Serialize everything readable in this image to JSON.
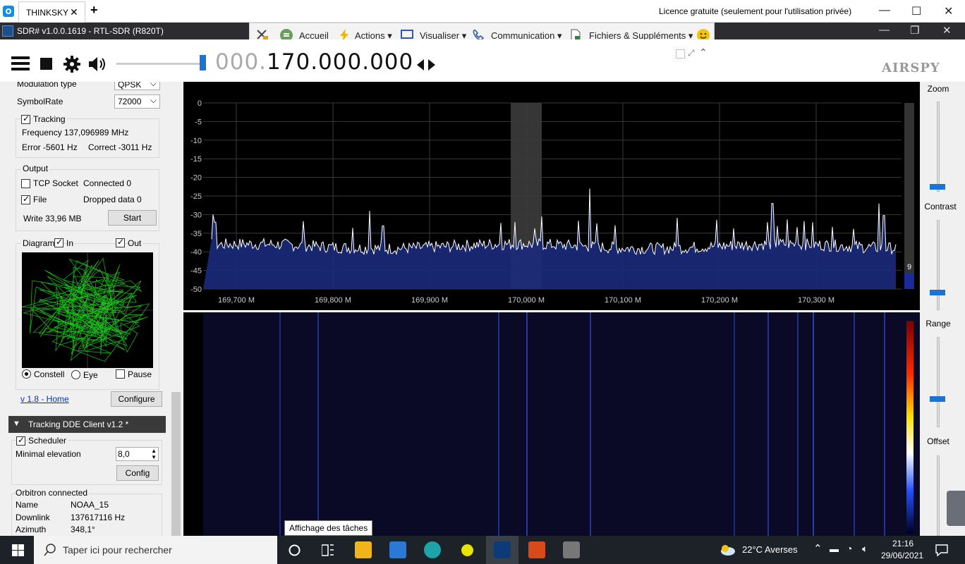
{
  "tv": {
    "tab_label": "THINKSKY",
    "tab_close": "✕",
    "new_tab": "+",
    "licence": "Licence gratuite (seulement pour l'utilisation privée)",
    "toolbar": {
      "home": "Accueil",
      "actions": "Actions",
      "view": "Visualiser",
      "comm": "Communication",
      "files": "Fichiers & Suppléments"
    }
  },
  "window": {
    "title": "SDR# v1.0.0.1619 - RTL-SDR (R820T)"
  },
  "frequency": {
    "dim_part": "000.",
    "main_part": "170.000.000"
  },
  "brand": "AIRSPY",
  "demod": {
    "modulation_label": "Modulation type",
    "modulation_value": "QPSK",
    "symbolrate_label": "SymbolRate",
    "symbolrate_value": "72000",
    "tracking_label": "Tracking",
    "frequency_text": "Frequency 137,096989 MHz",
    "error_text": "Error -5601 Hz",
    "correct_text": "Correct -3011 Hz"
  },
  "output": {
    "title": "Output",
    "tcp_label": "TCP Socket",
    "connected_text": "Connected 0",
    "file_label": "File",
    "dropped_text": "Dropped data 0",
    "write_text": "Write 33,96 MB",
    "start_button": "Start"
  },
  "diagram": {
    "title": "Diagram",
    "in_label": "In",
    "out_label": "Out",
    "constell_label": "Constell",
    "eye_label": "Eye",
    "pause_label": "Pause",
    "home_link": "v 1.8 - Home",
    "configure_button": "Configure"
  },
  "dde": {
    "header": "Tracking DDE Client v1.2 *",
    "scheduler_label": "Scheduler",
    "min_elev_label": "Minimal elevation",
    "min_elev_value": "8,0",
    "config_button": "Config",
    "orbitron": "Orbitron connected",
    "rows": [
      {
        "k": "Name",
        "v": "NOAA_15"
      },
      {
        "k": "Downlink",
        "v": "137617116 Hz"
      },
      {
        "k": "Azimuth",
        "v": "348,1°"
      }
    ]
  },
  "spectrum": {
    "y_ticks": [
      "0",
      "-5",
      "-10",
      "-15",
      "-20",
      "-25",
      "-30",
      "-35",
      "-40",
      "-45",
      "-50"
    ],
    "x_ticks": [
      "169,700 M",
      "169,800 M",
      "169,900 M",
      "170,000 M",
      "170,100 M",
      "170,200 M",
      "170,300 M"
    ],
    "scale_value": "9",
    "peaks": [
      {
        "f": "169,676 M",
        "db": -30
      },
      {
        "f": "169,838 M",
        "db": -29
      },
      {
        "f": "170,066 M",
        "db": -23
      },
      {
        "f": "170,255 M",
        "db": -27
      },
      {
        "f": "170,365 M",
        "db": -27
      }
    ]
  },
  "right_sliders": {
    "zoom": "Zoom",
    "contrast": "Contrast",
    "range": "Range",
    "offset": "Offset"
  },
  "taskbar": {
    "search_placeholder": "Taper ici pour rechercher",
    "tooltip": "Affichage des tâches",
    "weather": "22°C  Averses",
    "time": "21:16",
    "date": "29/06/2021"
  }
}
